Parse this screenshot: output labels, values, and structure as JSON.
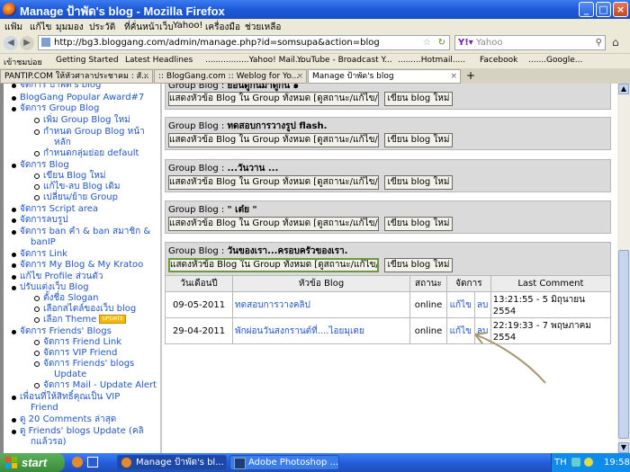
{
  "window": {
    "title": "Manage ป้าพัด's blog - Mozilla Firefox",
    "min": "_",
    "max": "□",
    "close": "×"
  },
  "menu": [
    "แฟ้ม",
    "แก้ไข",
    "มุมมอง",
    "ประวัติ",
    "ที่คั่นหน้าเว็บ",
    "Yahoo!",
    "เครื่องมือ",
    "ช่วยเหลือ"
  ],
  "nav": {
    "url": "http://bg3.bloggang.com/admin/manage.php?id=somsupa&action=blog",
    "search_placeholder": "Yahoo"
  },
  "bookmarks": [
    "เข้าชมบ่อย",
    "Getting Started",
    "Latest Headlines",
    ".................Yahoo! Mail...",
    "YouTube - Broadcast Y...",
    ".........Hotmail.....",
    "Facebook",
    ".......Google..."
  ],
  "tabs": [
    {
      "label": "PANTIP.COM ให้หัวศาลาประชาคม : สั..."
    },
    {
      "label": ":: BlogGang.com :: Weblog for Yo..."
    },
    {
      "label": "Manage ป้าพัด's blog"
    }
  ],
  "new_tab": "+",
  "sidebar": {
    "items": [
      {
        "label": "จัดการ ป้าพัด's blog",
        "level": 0
      },
      {
        "label": "BlogGang Popular Award#7",
        "level": 0
      },
      {
        "label": "จัดการ Group Blog",
        "level": 0
      },
      {
        "label": "เพิ่ม Group Blog ใหม่",
        "level": 1
      },
      {
        "label": "กำหนด Group Blog หน้า",
        "level": 1
      },
      {
        "label": "หลัก",
        "level": 2
      },
      {
        "label": "กำหนดกลุ่มย่อย default",
        "level": 1
      },
      {
        "label": "จัดการ Blog",
        "level": 0
      },
      {
        "label": "เขียน Blog ใหม่",
        "level": 1
      },
      {
        "label": "แก้ไข-ลบ Blog เดิม",
        "level": 1
      },
      {
        "label": "เปลี่ยน/ย้าย Group",
        "level": 1
      },
      {
        "label": "จัดการ Script area",
        "level": 0
      },
      {
        "label": "จัดการลบรูป",
        "level": 0
      },
      {
        "label": "จัดการ ban คำ & ban สมาชิก &",
        "level": 0
      },
      {
        "label": "banIP",
        "level": 2
      },
      {
        "label": "จัดการ Link",
        "level": 0
      },
      {
        "label": "จัดการ My Blog & My Kratoo",
        "level": 0
      },
      {
        "label": "แก้ไข Profile ส่วนตัว",
        "level": 0
      },
      {
        "label": "ปรับแต่งเว็บ Blog",
        "level": 0
      },
      {
        "label": "ตั้งชื่อ Slogan",
        "level": 1
      },
      {
        "label": "เลือกสไตล์ของเว็บ blog",
        "level": 1
      },
      {
        "label": "เลือก Theme",
        "level": 1
      },
      {
        "label": "จัดการ Friends' Blogs",
        "level": 0
      },
      {
        "label": "จัดการ Friend Link",
        "level": 1
      },
      {
        "label": "จัดการ VIP Friend",
        "level": 1
      },
      {
        "label": "จัดการ Friends' blogs",
        "level": 1
      },
      {
        "label": "Update",
        "level": 2
      },
      {
        "label": "จัดการ Mail - Update Alert",
        "level": 1
      },
      {
        "label": "เพื่อนที่ให้สิทธิ์คุณเป็น VIP",
        "level": 0
      },
      {
        "label": "Friend",
        "level": 3
      },
      {
        "label": "ดู 20 Comments ล่าสุด",
        "level": 0
      },
      {
        "label": "ดู Friends' blogs Update (คลิ",
        "level": 0
      },
      {
        "label": "กแล้วรอ)",
        "level": 3
      }
    ],
    "badge": "UPDATE"
  },
  "groups": [
    {
      "prefix": "Group Blog :",
      "name": "ย้อนดูกันมาดูกัน ๑"
    },
    {
      "prefix": "Group Blog :",
      "name": "ทดสอบการวางรูป flash."
    },
    {
      "prefix": "Group Blog :",
      "name": "...วันวาน ..."
    },
    {
      "prefix": "Group Blog :",
      "name": "\" เต๋ย \""
    },
    {
      "prefix": "Group Blog :",
      "name": "วันของเรา...ครอบครัวของเรา."
    }
  ],
  "buttons": {
    "show": "แสดงหัวข้อ Blog ใน Group ทั้งหมด [ดูสถานะ/แก้ไข/ลบ]",
    "write": "เขียน blog ใหม่"
  },
  "table": {
    "headers": [
      "วันเดือนปี",
      "หัวข้อ Blog",
      "สถานะ",
      "จัดการ",
      "",
      "Last Comment"
    ],
    "rows": [
      {
        "date": "09-05-2011",
        "title": "ทดสอบการวางคลิป",
        "status": "online",
        "edit": "แก้ไข",
        "del": "ลบ",
        "comment": "13:21:55 - 5 มิถุนายน 2554"
      },
      {
        "date": "29-04-2011",
        "title": "พักผ่อนวันสงกรานต์ที่....ไอยมุเตย",
        "status": "online",
        "edit": "แก้ไข",
        "del": "ลบ",
        "comment": "22:19:33 - 7 พฤษภาคม 2554"
      }
    ]
  },
  "taskbar": {
    "start": "start",
    "tasks": [
      "Manage ป้าพัด's bl...",
      "Adobe Photoshop ..."
    ],
    "lang": "TH",
    "clock": "19:58"
  }
}
